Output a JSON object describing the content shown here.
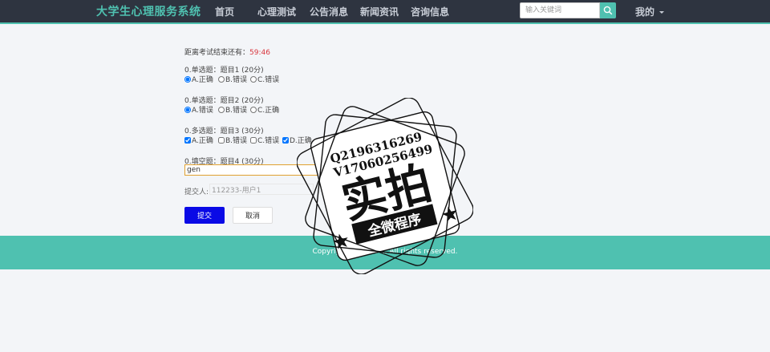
{
  "navbar": {
    "brand": "大学生心理服务系统",
    "items": [
      "首页",
      "心理测试",
      "公告消息",
      "新闻资讯",
      "咨询信息"
    ],
    "search_placeholder": "输入关键词",
    "user_menu": "我的"
  },
  "exam": {
    "timer_label": "距离考试结束还有：",
    "timer_value": "59:46",
    "questions": [
      {
        "title": "0.单选题：题目1 (20分)",
        "options": [
          {
            "label": "A.正确",
            "checked": true
          },
          {
            "label": "B.错误",
            "checked": false
          },
          {
            "label": "C.错误",
            "checked": false
          }
        ]
      },
      {
        "title": "0.单选题：题目2 (20分)",
        "options": [
          {
            "label": "A.错误",
            "checked": true
          },
          {
            "label": "B.错误",
            "checked": false
          },
          {
            "label": "C.正确",
            "checked": false
          }
        ]
      },
      {
        "title": "0.多选题：题目3 (30分)",
        "options": [
          {
            "label": "A.正确",
            "checked": true
          },
          {
            "label": "B.错误",
            "checked": false
          },
          {
            "label": "C.错误",
            "checked": false
          },
          {
            "label": "D.正确",
            "checked": true
          }
        ]
      },
      {
        "title": "0.填空题：题目4 (30分)",
        "answer": "gen"
      }
    ],
    "submitter_label": "提交人:",
    "submitter_value": "112233-用户1",
    "submit_label": "提交",
    "cancel_label": "取消"
  },
  "footer": {
    "copyright": "Copyright © 2022 ... All rights reserved."
  },
  "watermark": {
    "line1": "Q2196316269",
    "line2": "V17060256499",
    "big_text": "实拍",
    "ribbon_text": "全微程序"
  },
  "colors": {
    "navbar_bg": "#2e3440",
    "accent": "#4fc1b0",
    "submit_button": "#0a0ae6",
    "timer_value": "#d9363e"
  }
}
